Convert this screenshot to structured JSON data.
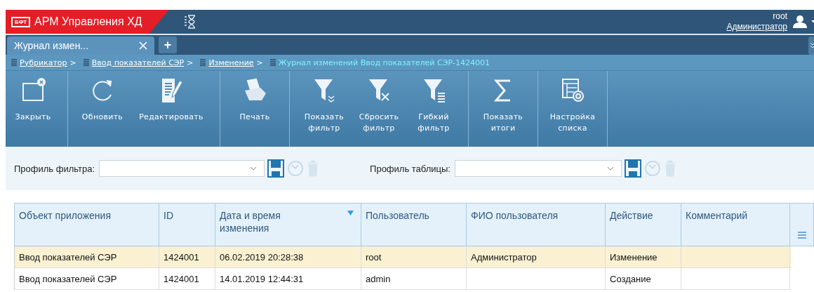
{
  "header": {
    "logo": "БФТ",
    "title": "АРМ Управления ХД",
    "user": "root",
    "role": "Администратор"
  },
  "tabs": [
    {
      "label": "Журнал измен...",
      "selected": true
    }
  ],
  "add_tab": "+",
  "breadcrumbs": [
    {
      "label": "Рубрикатор",
      "current": false,
      "separator": ">"
    },
    {
      "label": "Ввод показателей СЭР",
      "current": false,
      "separator": ">"
    },
    {
      "label": "Изменение",
      "current": false,
      "separator": ">"
    },
    {
      "label": "Журнал изменений Ввод показателей СЭР-1424001",
      "current": true
    }
  ],
  "toolbar": [
    [
      {
        "kind": "close",
        "label": "Закрыть"
      }
    ],
    [
      {
        "kind": "refresh",
        "label": "Обновить"
      },
      {
        "kind": "edit",
        "label": "Редактировать"
      }
    ],
    [
      {
        "kind": "print",
        "label": "Печать"
      }
    ],
    [
      {
        "kind": "filter-show",
        "label": "Показать фильтр"
      },
      {
        "kind": "filter-reset",
        "label": "Сбросить фильтр"
      },
      {
        "kind": "filter-flex",
        "label": "Гибкий фильтр"
      }
    ],
    [
      {
        "kind": "sum",
        "label": "Показать итоги"
      }
    ],
    [
      {
        "kind": "list-settings",
        "label": "Настройка списка"
      }
    ]
  ],
  "profiles": [
    {
      "label": "Профиль фильтра:"
    },
    {
      "label": "Профиль таблицы:"
    }
  ],
  "table": {
    "columns": [
      {
        "label": "Объект приложения",
        "sorted": false
      },
      {
        "label": "ID",
        "sorted": false
      },
      {
        "label": "Дата и время изменения",
        "sorted": true
      },
      {
        "label": "Пользователь",
        "sorted": false
      },
      {
        "label": "ФИО пользователя",
        "sorted": false
      },
      {
        "label": "Действие",
        "sorted": false
      },
      {
        "label": "Комментарий",
        "sorted": false
      }
    ],
    "rows": [
      {
        "selected": true,
        "cells": [
          "Ввод показателей СЭР",
          "1424001",
          "06.02.2019 20:28:38",
          "root",
          "Администратор",
          "Изменение",
          ""
        ]
      },
      {
        "selected": false,
        "cells": [
          "Ввод показателей СЭР",
          "1424001",
          "14.01.2019 12:44:31",
          "admin",
          "",
          "Создание",
          ""
        ]
      }
    ]
  }
}
